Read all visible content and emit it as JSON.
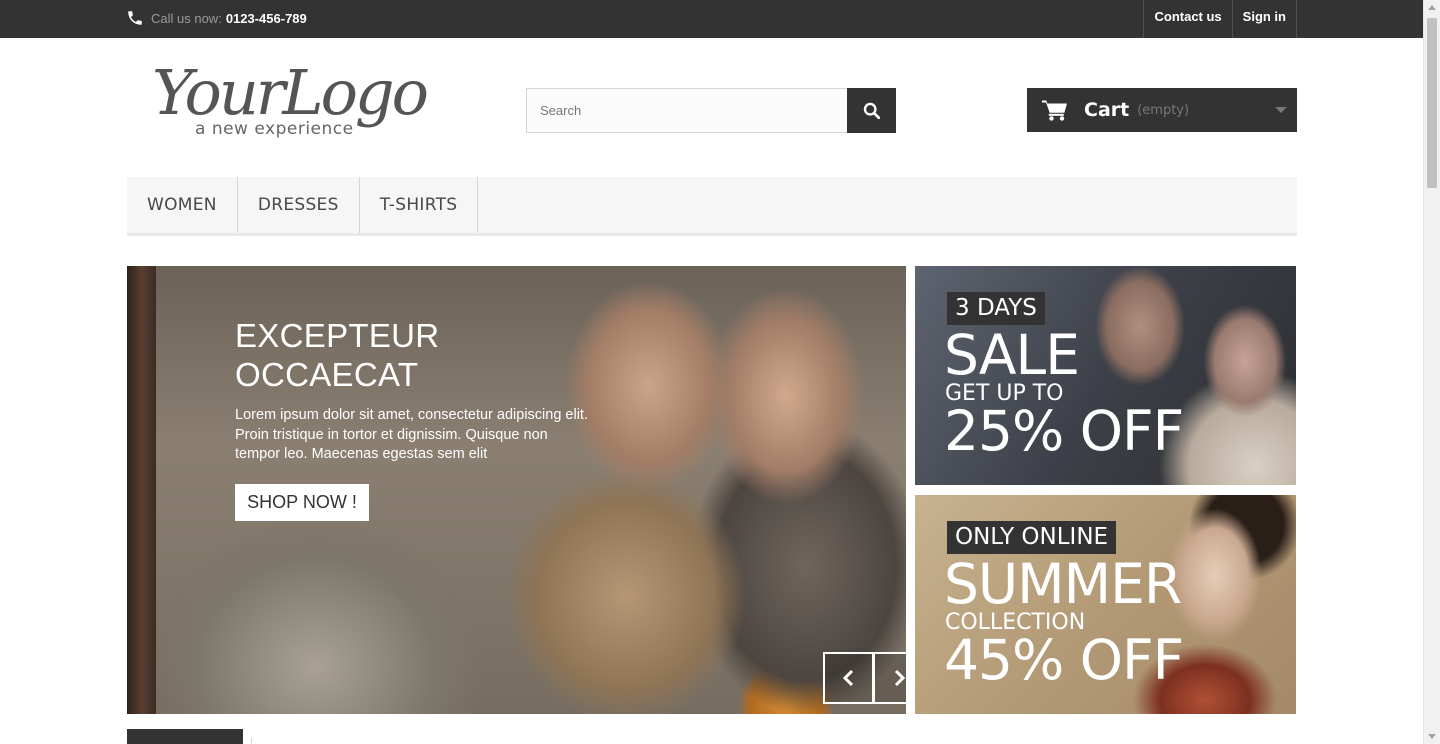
{
  "topbar": {
    "call_label": "Call us now:",
    "phone": "0123-456-789",
    "links": [
      "Contact us",
      "Sign in"
    ]
  },
  "logo": {
    "script": "YourLogo",
    "tagline": "a new experience"
  },
  "search": {
    "placeholder": "Search"
  },
  "cart": {
    "label": "Cart",
    "status": "(empty)"
  },
  "menu": {
    "items": [
      "WOMEN",
      "DRESSES",
      "T-SHIRTS"
    ]
  },
  "slider": {
    "title_line1": "EXCEPTEUR",
    "title_line2": "OCCAECAT",
    "description": "Lorem ipsum dolor sit amet, consectetur adipiscing elit. Proin tristique in tortor et dignissim. Quisque non tempor leo. Maecenas egestas sem elit",
    "button": "SHOP NOW !"
  },
  "banners": [
    {
      "tag": "3 DAYS",
      "big": "SALE",
      "small": "GET UP TO",
      "pct": "25% OFF"
    },
    {
      "tag": "ONLY ONLINE",
      "big": "SUMMER",
      "small": "COLLECTION",
      "pct": "45% OFF"
    }
  ],
  "colors": {
    "dark": "#333333",
    "menu_bg": "#f6f6f6",
    "border": "#d6d4d4"
  },
  "icons": [
    "phone-icon",
    "search-icon",
    "cart-icon",
    "chevron-down-icon",
    "chevron-left-icon",
    "chevron-right-icon"
  ]
}
